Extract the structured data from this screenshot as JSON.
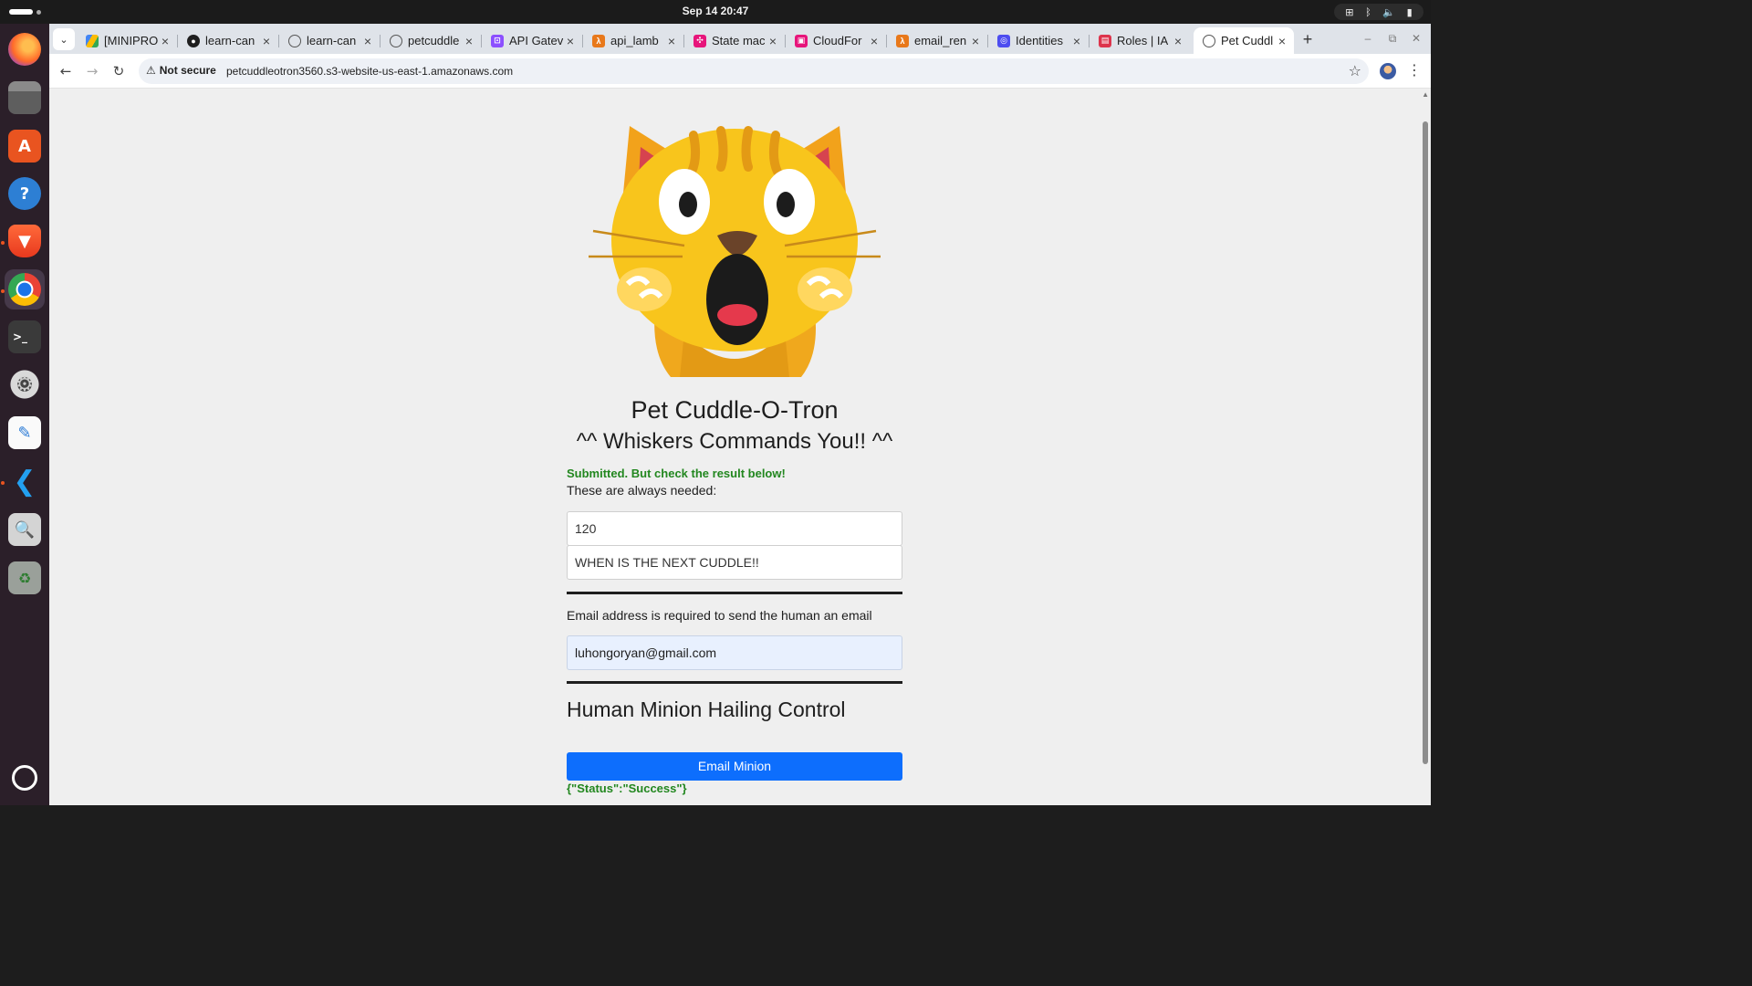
{
  "system": {
    "clock": "Sep 14  20:47",
    "tray_icons": [
      "network-icon",
      "bluetooth-icon",
      "volume-icon",
      "battery-icon"
    ]
  },
  "dock": {
    "apps": [
      "firefox",
      "files",
      "app-center",
      "help",
      "brave",
      "chrome",
      "terminal",
      "settings",
      "text-editor",
      "vscode",
      "image-viewer",
      "trash",
      "show-apps"
    ]
  },
  "browser": {
    "tabs": [
      {
        "title": "[MINIPRO",
        "favicon": "drive"
      },
      {
        "title": "learn-can",
        "favicon": "github"
      },
      {
        "title": "learn-can",
        "favicon": "globe"
      },
      {
        "title": "petcuddle",
        "favicon": "globe"
      },
      {
        "title": "API Gatev",
        "favicon": "apigw"
      },
      {
        "title": "api_lamb",
        "favicon": "lambda"
      },
      {
        "title": "State mac",
        "favicon": "stepfn"
      },
      {
        "title": "CloudFor",
        "favicon": "cloudformation"
      },
      {
        "title": "email_ren",
        "favicon": "lambda"
      },
      {
        "title": "Identities",
        "favicon": "ses"
      },
      {
        "title": "Roles | IA",
        "favicon": "iam"
      },
      {
        "title": "Pet Cuddl",
        "favicon": "globe",
        "active": true
      }
    ],
    "security_label": "Not secure",
    "url": "petcuddleotron3560.s3-website-us-east-1.amazonaws.com"
  },
  "page": {
    "title": "Pet Cuddle-O-Tron",
    "subtitle": "^^ Whiskers Commands You!! ^^",
    "submitted_msg": "Submitted. But check the result below!",
    "needed_label": "These are always needed:",
    "minutes_value": "120",
    "message_value": "WHEN IS THE NEXT CUDDLE!!",
    "email_label": "Email address is required to send the human an email",
    "email_value": "luhongoryan@gmail.com",
    "control_title": "Human Minion Hailing Control",
    "email_button": "Email Minion",
    "result": "{\"Status\":\"Success\"}"
  },
  "colors": {
    "accent_button": "#0d6efd",
    "success_text": "#22871f",
    "page_bg": "#efefef"
  }
}
